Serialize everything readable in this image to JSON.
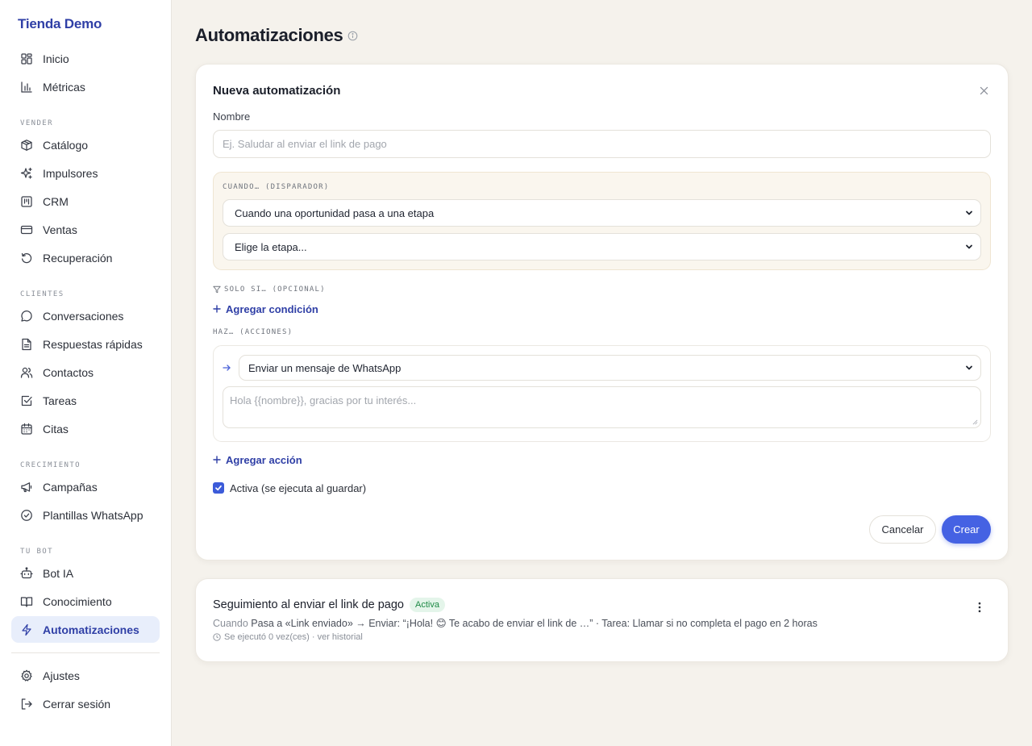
{
  "brand": "Tienda Demo",
  "sidebar": {
    "top": [
      {
        "label": "Inicio",
        "icon": "grid-icon"
      },
      {
        "label": "Métricas",
        "icon": "bar-chart-icon"
      }
    ],
    "sections": [
      {
        "title": "VENDER",
        "items": [
          {
            "label": "Catálogo",
            "icon": "box-icon"
          },
          {
            "label": "Impulsores",
            "icon": "sparkles-icon"
          },
          {
            "label": "CRM",
            "icon": "kanban-icon"
          },
          {
            "label": "Ventas",
            "icon": "credit-card-icon"
          },
          {
            "label": "Recuperación",
            "icon": "rotate-ccw-icon"
          }
        ]
      },
      {
        "title": "CLIENTES",
        "items": [
          {
            "label": "Conversaciones",
            "icon": "message-circle-icon"
          },
          {
            "label": "Respuestas rápidas",
            "icon": "file-text-icon"
          },
          {
            "label": "Contactos",
            "icon": "users-icon"
          },
          {
            "label": "Tareas",
            "icon": "check-square-icon"
          },
          {
            "label": "Citas",
            "icon": "calendar-icon"
          }
        ]
      },
      {
        "title": "CRECIMIENTO",
        "items": [
          {
            "label": "Campañas",
            "icon": "megaphone-icon"
          },
          {
            "label": "Plantillas WhatsApp",
            "icon": "check-circle-icon"
          }
        ]
      },
      {
        "title": "TU BOT",
        "items": [
          {
            "label": "Bot IA",
            "icon": "bot-icon"
          },
          {
            "label": "Conocimiento",
            "icon": "book-open-icon"
          },
          {
            "label": "Automatizaciones",
            "icon": "zap-icon",
            "active": true
          }
        ]
      }
    ],
    "bottom": [
      {
        "label": "Ajustes",
        "icon": "settings-icon"
      },
      {
        "label": "Cerrar sesión",
        "icon": "log-out-icon"
      }
    ]
  },
  "page": {
    "title": "Automatizaciones"
  },
  "form": {
    "title": "Nueva automatización",
    "name_label": "Nombre",
    "name_value": "",
    "name_placeholder": "Ej. Saludar al enviar el link de pago",
    "trigger_label": "CUANDO… (DISPARADOR)",
    "trigger_select": "Cuando una oportunidad pasa a una etapa",
    "stage_select": "Elige la etapa...",
    "condition_label": "SOLO SI… (OPCIONAL)",
    "add_condition": "Agregar condición",
    "actions_label": "HAZ… (ACCIONES)",
    "action_select": "Enviar un mensaje de WhatsApp",
    "message_placeholder": "Hola {{nombre}}, gracias por tu interés...",
    "add_action": "Agregar acción",
    "active_label": "Activa (se ejecuta al guardar)",
    "active_checked": true,
    "cancel": "Cancelar",
    "create": "Crear"
  },
  "automations": [
    {
      "title": "Seguimiento al enviar el link de pago",
      "badge": "Activa",
      "when": "Cuando",
      "desc": "Pasa a «Link enviado» → Enviar: “¡Hola! 😊 Te acabo de enviar el link de …” · Tarea: Llamar si no completa el pago en 2 horas",
      "runs": "Se ejecutó 0 vez(ces)",
      "sep": "·",
      "history": "ver historial"
    }
  ],
  "colors": {
    "accent": "#4562e3",
    "brand": "#2f3fa6",
    "active_badge": "#1e8a46",
    "background": "#f5f2ec"
  }
}
